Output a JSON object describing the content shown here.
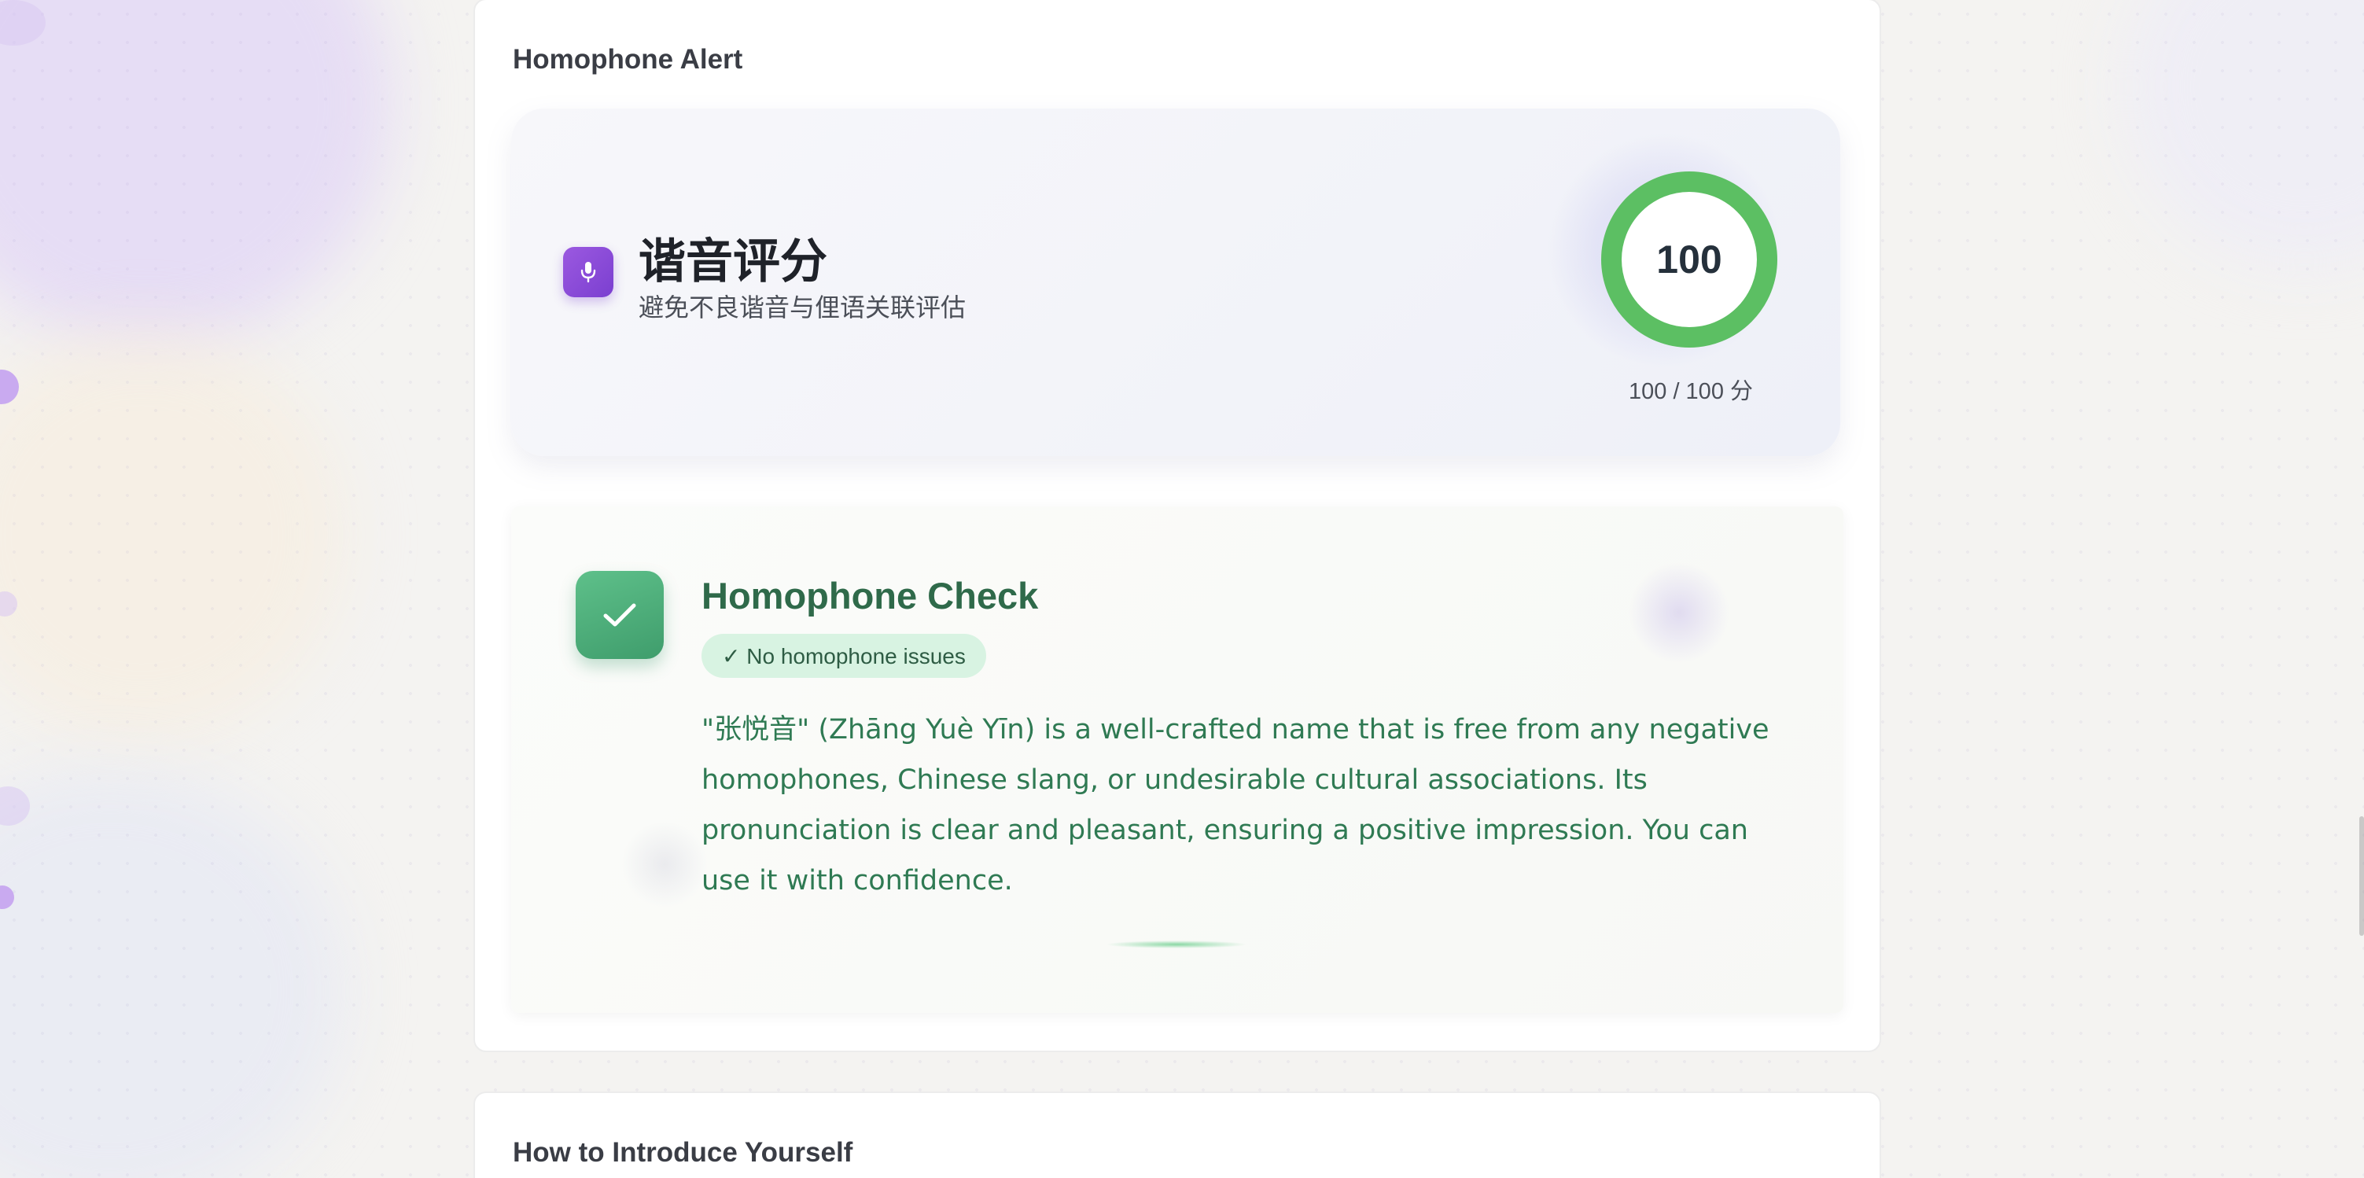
{
  "homophone_card": {
    "title": "Homophone Alert",
    "score": {
      "title": "谐音评分",
      "subtitle": "避免不良谐音与俚语关联评估",
      "icon": "microphone-icon",
      "value": "100",
      "value_numeric": 100,
      "max": 100,
      "caption": "100 / 100 分",
      "ring_color": "#5cbf63",
      "badge_color": "#8e4fdc"
    },
    "check": {
      "icon": "checkmark-icon",
      "title": "Homophone Check",
      "status": "✓ No homophone issues",
      "description": "\"张悦音\" (Zhāng Yuè Yīn) is a well-crafted name that is free from any negative homophones, Chinese slang, or undesirable cultural associations. Its pronunciation is clear and pleasant, ensuring a positive impression. You can use it with confidence.",
      "accent_color": "#3f9d6c"
    }
  },
  "next_card": {
    "title": "How to Introduce Yourself"
  }
}
